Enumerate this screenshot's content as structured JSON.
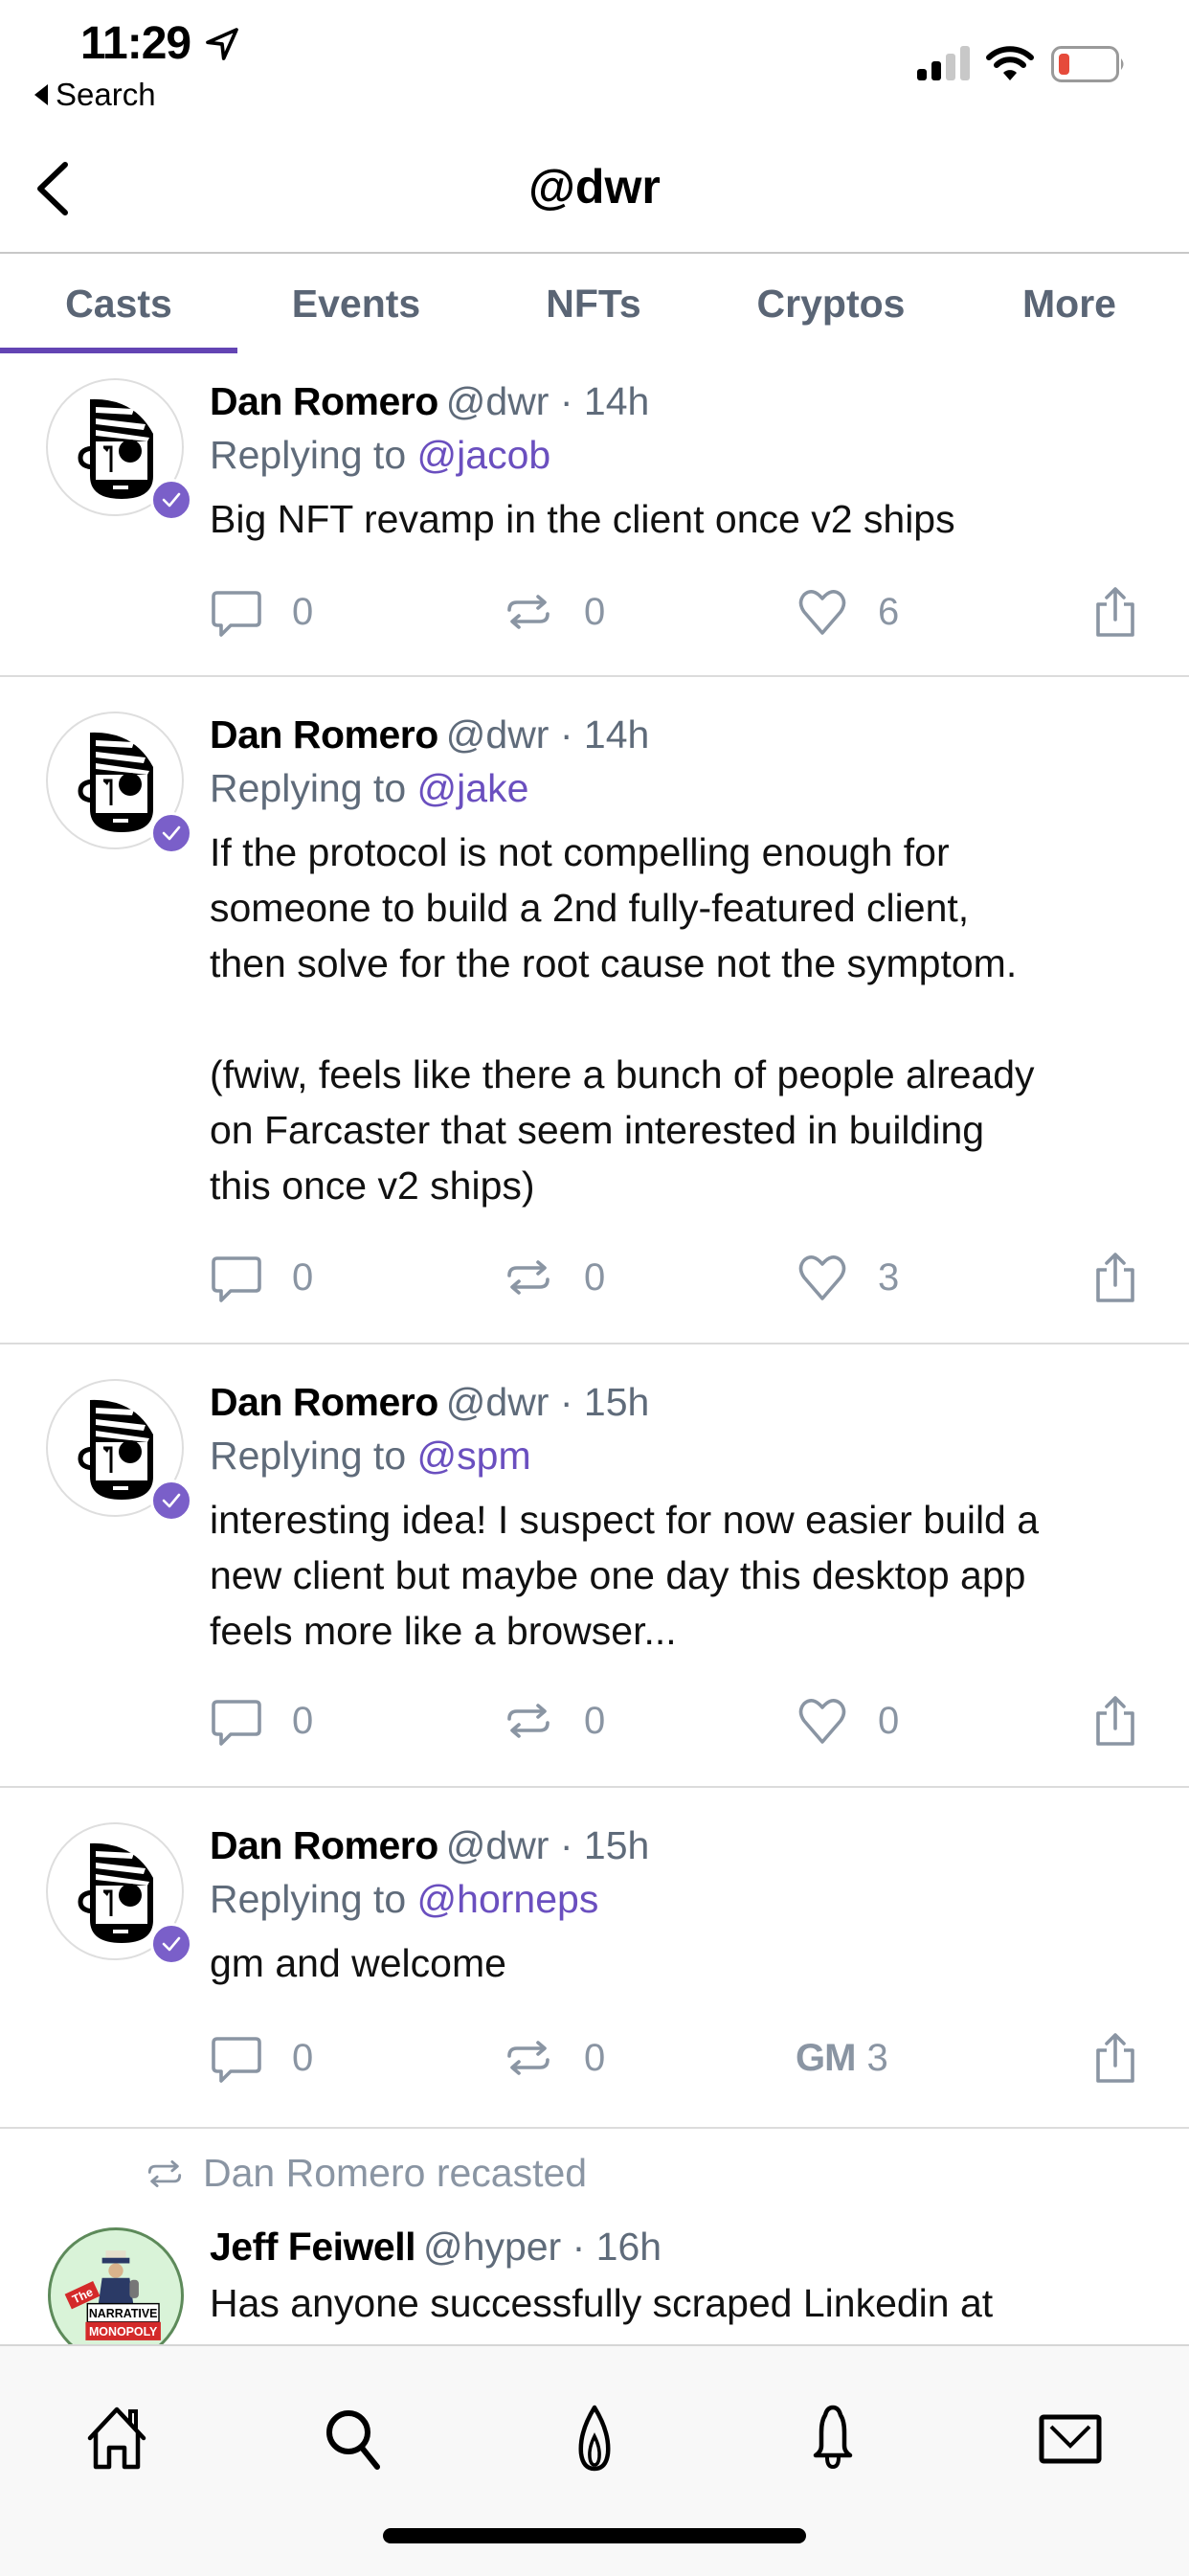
{
  "status_bar": {
    "time": "11:29",
    "back_app_label": "Search",
    "battery_color": "#e64b3b"
  },
  "nav": {
    "title": "@dwr",
    "back_icon": "chevron-left-icon"
  },
  "tabs": [
    {
      "label": "Casts",
      "active": true
    },
    {
      "label": "Events",
      "active": false
    },
    {
      "label": "NFTs",
      "active": false
    },
    {
      "label": "Cryptos",
      "active": false
    },
    {
      "label": "More",
      "active": false
    }
  ],
  "colors": {
    "accent": "#6344b3",
    "mention": "#6a4fbf",
    "verified_badge": "#7a5fc9",
    "muted_text": "#5f6b7a",
    "action_icon": "#8a95a3"
  },
  "casts": [
    {
      "author": "Dan Romero",
      "handle": "@dwr",
      "time": "14h",
      "replying_prefix": "Replying to",
      "replying_to": "@jacob",
      "text": "Big NFT revamp in the client once v2 ships",
      "replies": "0",
      "recasts": "0",
      "reaction_type": "like",
      "reactions": "6",
      "verified": true
    },
    {
      "author": "Dan Romero",
      "handle": "@dwr",
      "time": "14h",
      "replying_prefix": "Replying to",
      "replying_to": "@jake",
      "text": "If the protocol is not compelling enough for\nsomeone to build a 2nd fully-featured client,\nthen solve for the root cause not the symptom.\n\n(fwiw, feels like there a bunch of people already\non Farcaster that seem interested in building\nthis once v2 ships)",
      "replies": "0",
      "recasts": "0",
      "reaction_type": "like",
      "reactions": "3",
      "verified": true
    },
    {
      "author": "Dan Romero",
      "handle": "@dwr",
      "time": "15h",
      "replying_prefix": "Replying to",
      "replying_to": "@spm",
      "text": "interesting idea! I suspect for now easier build a\nnew client but maybe one day this desktop app\nfeels more like a browser...",
      "replies": "0",
      "recasts": "0",
      "reaction_type": "like",
      "reactions": "0",
      "verified": true
    },
    {
      "author": "Dan Romero",
      "handle": "@dwr",
      "time": "15h",
      "replying_prefix": "Replying to",
      "replying_to": "@horneps",
      "text": "gm and welcome",
      "replies": "0",
      "recasts": "0",
      "reaction_type": "gm",
      "reaction_label": "GM",
      "reactions": "3",
      "verified": true
    }
  ],
  "recast_item": {
    "recast_label": "Dan Romero recasted",
    "author": "Jeff Feiwell",
    "handle": "@hyper",
    "time": "16h",
    "text": "Has anyone successfully scraped Linkedin at",
    "avatar_text": {
      "the": "The",
      "line1": "NARRATIVE",
      "line2": "MONOPOLY"
    }
  },
  "bottom_tabs": [
    {
      "name": "home",
      "icon": "home-icon"
    },
    {
      "name": "search",
      "icon": "search-icon"
    },
    {
      "name": "trending",
      "icon": "flame-icon"
    },
    {
      "name": "notifications",
      "icon": "bell-icon"
    },
    {
      "name": "messages",
      "icon": "mail-icon"
    }
  ]
}
